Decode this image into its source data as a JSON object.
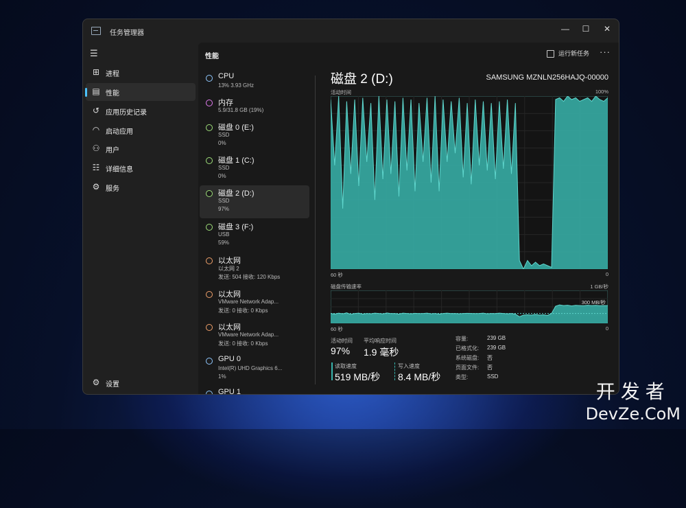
{
  "window": {
    "title": "任务管理器",
    "minimize": "—",
    "maximize": "☐",
    "close": "✕"
  },
  "sidebar": {
    "items": [
      {
        "label": "进程",
        "icon": "processes-icon"
      },
      {
        "label": "性能",
        "icon": "performance-icon"
      },
      {
        "label": "应用历史记录",
        "icon": "history-icon"
      },
      {
        "label": "启动应用",
        "icon": "startup-icon"
      },
      {
        "label": "用户",
        "icon": "users-icon"
      },
      {
        "label": "详细信息",
        "icon": "details-icon"
      },
      {
        "label": "服务",
        "icon": "services-icon"
      }
    ],
    "settings": "设置"
  },
  "header": {
    "title": "性能",
    "run_task": "运行新任务",
    "more": "···"
  },
  "devices": [
    {
      "name": "CPU",
      "l2": "13% 3.93 GHz",
      "l3": "",
      "color": "#8fc8ff"
    },
    {
      "name": "内存",
      "l2": "5.9/31.8 GB (19%)",
      "l3": "",
      "color": "#e37cf0"
    },
    {
      "name": "磁盘 0 (E:)",
      "l2": "SSD",
      "l3": "0%",
      "color": "#9fe07a"
    },
    {
      "name": "磁盘 1 (C:)",
      "l2": "SSD",
      "l3": "0%",
      "color": "#9fe07a"
    },
    {
      "name": "磁盘 2 (D:)",
      "l2": "SSD",
      "l3": "97%",
      "color": "#9fe07a"
    },
    {
      "name": "磁盘 3 (F:)",
      "l2": "USB",
      "l3": "59%",
      "color": "#9fe07a"
    },
    {
      "name": "以太网",
      "l2": "以太网 2",
      "l3": "发送: 504 接收: 120 Kbps",
      "color": "#f0a06a"
    },
    {
      "name": "以太网",
      "l2": "VMware Network Adap...",
      "l3": "发送: 0 接收: 0 Kbps",
      "color": "#f0a06a"
    },
    {
      "name": "以太网",
      "l2": "VMware Network Adap...",
      "l3": "发送: 0 接收: 0 Kbps",
      "color": "#f0a06a"
    },
    {
      "name": "GPU 0",
      "l2": "Intel(R) UHD Graphics 6...",
      "l3": "1%",
      "color": "#8fc8ff"
    },
    {
      "name": "GPU 1",
      "l2": "",
      "l3": "",
      "color": "#8fc8ff"
    }
  ],
  "detail": {
    "title": "磁盘 2 (D:)",
    "model": "SAMSUNG MZNLN256HAJQ-00000",
    "chart1": {
      "label": "活动时间",
      "max": "100%",
      "xlabel": "60 秒",
      "min": "0"
    },
    "chart2": {
      "label": "磁盘传输速率",
      "max": "1 GB/秒",
      "ref": "300 MB/秒",
      "xlabel": "60 秒",
      "min": "0"
    },
    "stats": {
      "active_label": "活动时间",
      "active": "97%",
      "resp_label": "平均响应时间",
      "resp": "1.9 毫秒",
      "read_label": "读取速度",
      "read": "519 MB/秒",
      "write_label": "写入速度",
      "write": "8.4 MB/秒"
    },
    "props": [
      {
        "k": "容量:",
        "v": "239 GB"
      },
      {
        "k": "已格式化:",
        "v": "239 GB"
      },
      {
        "k": "系统磁盘:",
        "v": "否"
      },
      {
        "k": "页面文件:",
        "v": "否"
      },
      {
        "k": "类型:",
        "v": "SSD"
      }
    ]
  },
  "chart_data": [
    {
      "type": "area",
      "title": "活动时间",
      "ylim": [
        0,
        100
      ],
      "series": [
        {
          "values": [
            98,
            60,
            100,
            35,
            97,
            55,
            98,
            48,
            99,
            62,
            96,
            40,
            100,
            52,
            98,
            55,
            97,
            42,
            99,
            57,
            98,
            45,
            96,
            62,
            99,
            50,
            100,
            45,
            98,
            62,
            97,
            67,
            99,
            53,
            96,
            49,
            98,
            60,
            97,
            57,
            96,
            52,
            97,
            58,
            98,
            55,
            96,
            5,
            0,
            5,
            2,
            4,
            2,
            3,
            2,
            1,
            98,
            99,
            97,
            100,
            98,
            99,
            97,
            98,
            99,
            97,
            100,
            98,
            97,
            99
          ]
        }
      ],
      "color": "#38b5ad"
    },
    {
      "type": "area",
      "title": "磁盘传输速率",
      "ylim": [
        0,
        1000
      ],
      "series": [
        {
          "values": [
            300,
            280,
            310,
            290,
            320,
            270,
            300,
            310,
            280,
            300,
            290,
            310,
            300,
            285,
            315,
            295,
            300,
            280,
            310,
            300,
            290,
            305,
            295,
            300,
            310,
            290,
            300,
            280,
            300,
            310,
            295,
            300,
            290,
            300,
            305,
            300,
            295,
            300,
            310,
            290,
            300,
            295,
            310,
            300,
            290,
            300,
            280,
            200,
            250,
            260,
            250,
            270,
            250,
            260,
            240,
            300,
            520,
            560,
            540,
            550,
            530,
            545,
            540,
            535,
            550,
            540,
            545,
            535,
            540,
            540
          ]
        }
      ],
      "color": "#38b5ad"
    }
  ],
  "watermark": {
    "line1": "开发者",
    "line2": "DevZe.CoM"
  }
}
